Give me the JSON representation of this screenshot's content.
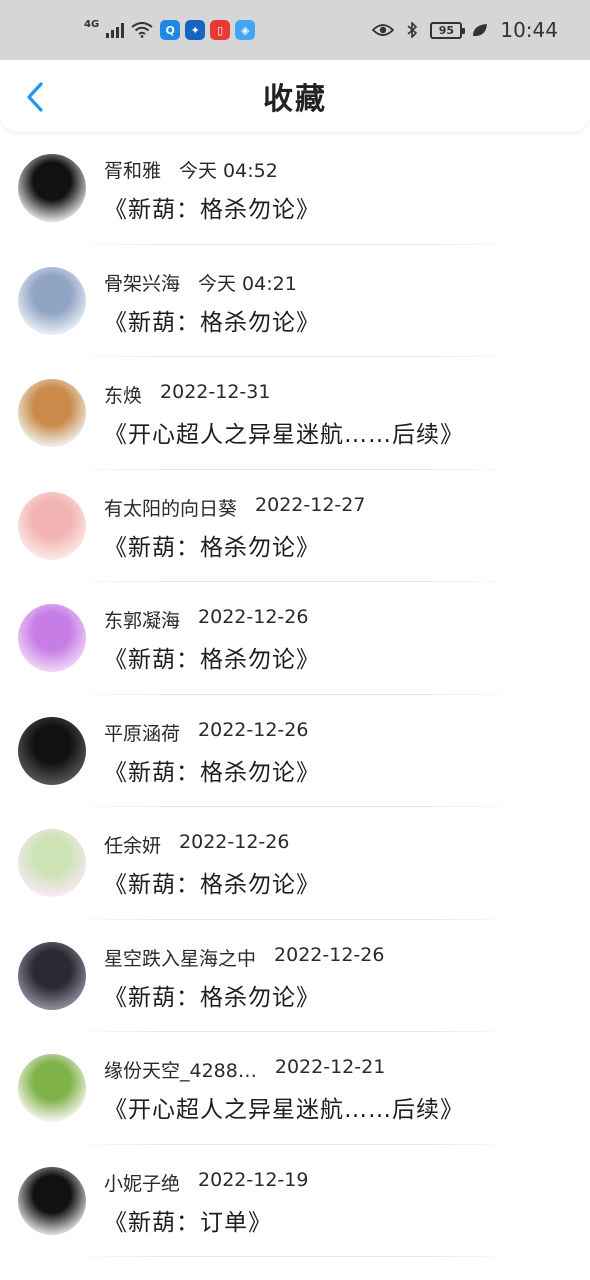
{
  "status": {
    "network": "4G",
    "battery": "95",
    "time": "10:44",
    "app_icons": [
      {
        "name": "search-app-icon",
        "color": "#1e88e5",
        "glyph": "Q"
      },
      {
        "name": "bulb-app-icon",
        "color": "#1565c0",
        "glyph": "✦"
      },
      {
        "name": "book-app-icon",
        "color": "#e53935",
        "glyph": "▯"
      },
      {
        "name": "compass-app-icon",
        "color": "#42a5f5",
        "glyph": "◈"
      }
    ]
  },
  "header": {
    "title": "收藏",
    "accent": "#2196f3"
  },
  "items": [
    {
      "user": "胥和雅",
      "time": "今天 04:52",
      "work": "《新葫：格杀勿论》",
      "avatar": [
        "#111",
        "#ddd"
      ]
    },
    {
      "user": "骨架兴海",
      "time": "今天 04:21",
      "work": "《新葫：格杀勿论》",
      "avatar": [
        "#8fa3c3",
        "#e6ecf5"
      ]
    },
    {
      "user": "东焕",
      "time": "2022-12-31",
      "work": "《开心超人之异星迷航……后续》",
      "avatar": [
        "#c98a4a",
        "#f0ebe4"
      ]
    },
    {
      "user": "有太阳的向日葵",
      "time": "2022-12-27",
      "work": "《新葫：格杀勿论》",
      "avatar": [
        "#f2b3b3",
        "#fbe9e4"
      ]
    },
    {
      "user": "东郭凝海",
      "time": "2022-12-26",
      "work": "《新葫：格杀勿论》",
      "avatar": [
        "#c77de6",
        "#f0d3f7"
      ]
    },
    {
      "user": "平原涵荷",
      "time": "2022-12-26",
      "work": "《新葫：格杀勿论》",
      "avatar": [
        "#111",
        "#555"
      ]
    },
    {
      "user": "任余妍",
      "time": "2022-12-26",
      "work": "《新葫：格杀勿论》",
      "avatar": [
        "#cde3b6",
        "#f7e9f3"
      ]
    },
    {
      "user": "星空跌入星海之中",
      "time": "2022-12-26",
      "work": "《新葫：格杀勿论》",
      "avatar": [
        "#2a2a33",
        "#8a8a9a"
      ]
    },
    {
      "user": "缘份天空_4288…",
      "time": "2022-12-21",
      "work": "《开心超人之异星迷航……后续》",
      "avatar": [
        "#7fb34a",
        "#f4f4ec"
      ]
    },
    {
      "user": "小妮子绝",
      "time": "2022-12-19",
      "work": "《新葫：订单》",
      "avatar": [
        "#111",
        "#d9d9d9"
      ]
    }
  ]
}
